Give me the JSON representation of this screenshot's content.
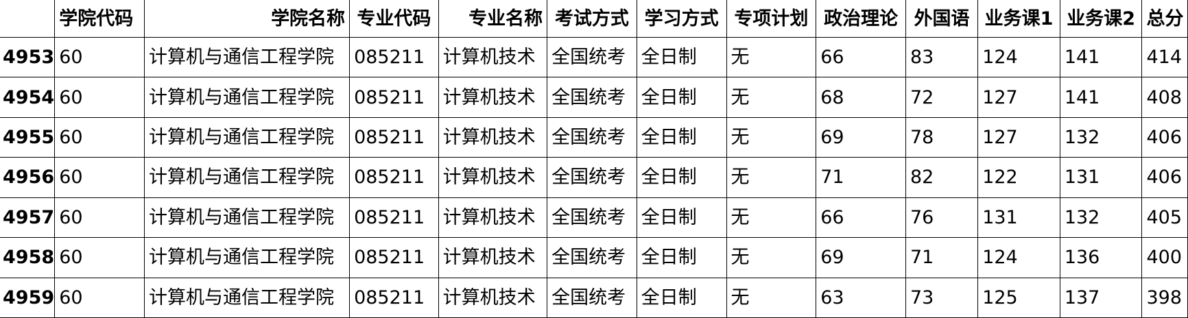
{
  "columns": [
    {
      "label": ""
    },
    {
      "label": "学院代码"
    },
    {
      "label": "学院名称"
    },
    {
      "label": "专业代码"
    },
    {
      "label": "专业名称"
    },
    {
      "label": "考试方式"
    },
    {
      "label": "学习方式"
    },
    {
      "label": "专项计划"
    },
    {
      "label": "政治理论"
    },
    {
      "label": "外国语"
    },
    {
      "label": "业务课1"
    },
    {
      "label": "业务课2"
    },
    {
      "label": "总分"
    }
  ],
  "rows": [
    [
      "4953",
      "60",
      "计算机与通信工程学院",
      "085211",
      "计算机技术",
      "全国统考",
      "全日制",
      "无",
      "66",
      "83",
      "124",
      "141",
      "414"
    ],
    [
      "4954",
      "60",
      "计算机与通信工程学院",
      "085211",
      "计算机技术",
      "全国统考",
      "全日制",
      "无",
      "68",
      "72",
      "127",
      "141",
      "408"
    ],
    [
      "4955",
      "60",
      "计算机与通信工程学院",
      "085211",
      "计算机技术",
      "全国统考",
      "全日制",
      "无",
      "69",
      "78",
      "127",
      "132",
      "406"
    ],
    [
      "4956",
      "60",
      "计算机与通信工程学院",
      "085211",
      "计算机技术",
      "全国统考",
      "全日制",
      "无",
      "71",
      "82",
      "122",
      "131",
      "406"
    ],
    [
      "4957",
      "60",
      "计算机与通信工程学院",
      "085211",
      "计算机技术",
      "全国统考",
      "全日制",
      "无",
      "66",
      "76",
      "131",
      "132",
      "405"
    ],
    [
      "4958",
      "60",
      "计算机与通信工程学院",
      "085211",
      "计算机技术",
      "全国统考",
      "全日制",
      "无",
      "69",
      "71",
      "124",
      "136",
      "400"
    ],
    [
      "4959",
      "60",
      "计算机与通信工程学院",
      "085211",
      "计算机技术",
      "全国统考",
      "全日制",
      "无",
      "63",
      "73",
      "125",
      "137",
      "398"
    ]
  ]
}
